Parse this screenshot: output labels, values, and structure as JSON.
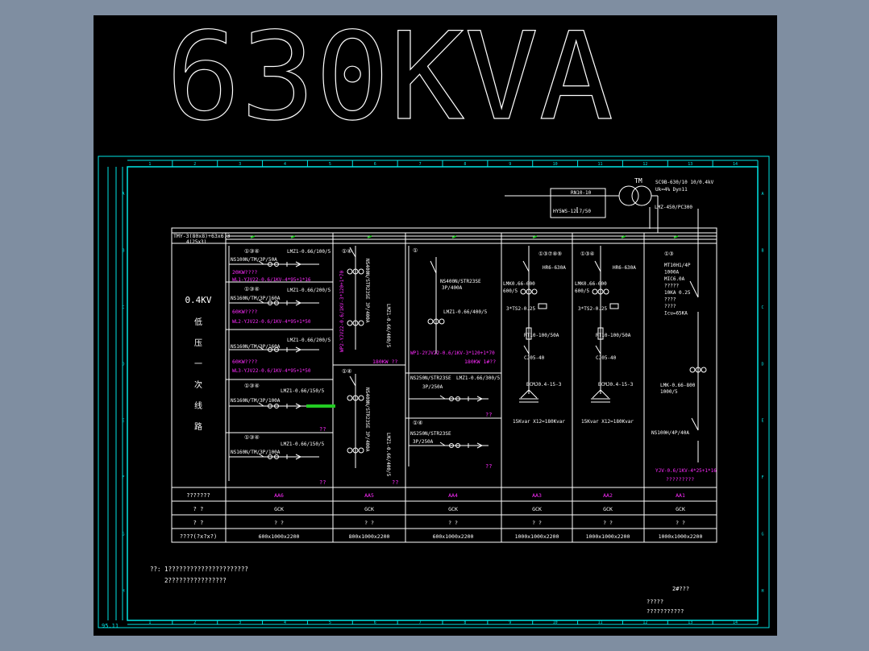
{
  "title": "630KVA",
  "colors": {
    "background": "#000000",
    "frame": "#00e5e5",
    "lines": "#ffffff",
    "magenta": "#ff2bff",
    "green": "#22cc22",
    "outer": "#7f8ea1"
  },
  "border_numbers": [
    "1",
    "2",
    "3",
    "4",
    "5",
    "6",
    "7",
    "8",
    "9",
    "10",
    "11",
    "12",
    "13",
    "14"
  ],
  "border_letters": [
    "A",
    "B",
    "C",
    "D",
    "E",
    "F",
    "G",
    "H"
  ],
  "corner_label": "95.11",
  "transformer": {
    "tm": "TM",
    "model": "SC9B-630/10 10/0.4kV",
    "params": "Uk=4% Dyn11",
    "ct": "LMZ-450/PC300",
    "fuse": "RN10-10",
    "arrester": "HY5WS-12.7/50"
  },
  "busbar": {
    "line1": "TMY-3(80x8)+63x6.3",
    "line2": "4(25x3)"
  },
  "left_label": [
    "0.4KV",
    "低",
    "压",
    "一",
    "次",
    "线",
    "路"
  ],
  "aa6": {
    "f1": {
      "nums": "①③④",
      "ct": "LMZ1-0.66/100/5",
      "brk": "NS100N/TM/3P/50A",
      "load": "20KW????",
      "cable": "WL1-YJV22-0.6/1KV-4*95+1*16"
    },
    "f2": {
      "nums": "①③④",
      "ct": "LMZ1-0.66/200/5",
      "brk": "NS160N/TM/3P/160A",
      "load": "60KW????",
      "cable": "WL2-YJV22-0.6/1KV-4*95+1*50"
    },
    "f3": {
      "ct": "LMZ1-0.66/200/5",
      "brk": "NS160N/TM/3P/160A",
      "load": "60KW????",
      "cable": "WL3-YJV22-0.6/1KV-4*95+1*50"
    },
    "f4": {
      "nums": "①③④",
      "ct": "LMZ1-0.66/150/5",
      "brk": "NS160N/TM/3P/100A",
      "q": "??"
    },
    "f5": {
      "nums": "①③④",
      "ct": "LMZ1-0.66/150/5",
      "brk": "NS160N/TM/3P/100A",
      "q": "??"
    }
  },
  "aa5": {
    "top": {
      "nums": "①④",
      "brk": "NS400N/STR23SE 3P/400A",
      "ct": "LMZ1-0.66/400/5",
      "cable": "WP2-YJV22-0.6/1KV-3*120+1*70",
      "load": "180KW ??"
    },
    "bot": {
      "nums": "①④",
      "brk": "NS400N/STR23SE 3P/400A",
      "ct": "LMZ1-0.66/400/5",
      "q": "??"
    }
  },
  "aa4": {
    "top": {
      "nums": "①",
      "brk": "NS400N/STR23SE",
      "brk2": "3P/400A",
      "ct": "LMZ1-0.66/400/5",
      "cable": "WP1-2YJV22-0.6/1KV-3*120+1*70",
      "load": "180KW 1#??"
    },
    "mid": {
      "brk": "NS250N/STR23SE",
      "ct": "LMZ1-0.66/300/5",
      "brk2": "3P/250A",
      "q": "??"
    },
    "bot": {
      "nums": "①④",
      "brk": "NS250N/STR23SE",
      "brk2": "3P/250A",
      "q": "??"
    }
  },
  "aa3": {
    "nums": "①③⑦⑧⑨",
    "sw": "HR6-630A",
    "ct": "LMK0.66-600",
    "ct2": "600/5",
    "ct3": "3*TS2-0.25",
    "fuse": "RT10-100/50A",
    "cont": "CJ05-40",
    "cap": "BCMJ0.4-15-3",
    "total": "15Kvar X12=180Kvar"
  },
  "aa2": {
    "nums": "①③④",
    "sw": "HR6-630A",
    "ct": "LMK0.66-600",
    "ct2": "600/5",
    "ct3": "3*TS2-0.25",
    "fuse": "RT10-100/50A",
    "cont": "CJ05-40",
    "cap": "BCMJ0.4-15-3",
    "total": "15Kvar X12=180Kvar"
  },
  "aa1": {
    "nums": "①③",
    "lines": [
      "MT10H1/4P",
      "1000A",
      "MIC6.0A",
      "?????",
      "10KA   0.25",
      "????",
      "????",
      "Icu=65KA"
    ],
    "ct": "LMK-0.66-800",
    "ct2": "1000/5",
    "brk2": "NS100H/4P/40A",
    "cable": "YJV-0.6/1KV-4*25+1*16",
    "bottom": "?????????"
  },
  "table": {
    "rows": [
      {
        "label": "???????",
        "values": [
          "AA6",
          "AA5",
          "AA4",
          "AA3",
          "AA2",
          "AA1"
        ]
      },
      {
        "label": "? ?",
        "values": [
          "GCK",
          "GCK",
          "GCK",
          "GCK",
          "GCK",
          "GCK"
        ]
      },
      {
        "label": "? ?",
        "values": [
          "? ?",
          "? ?",
          "? ?",
          "? ?",
          "? ?",
          "? ?"
        ]
      },
      {
        "label": "????(?x?x?)",
        "values": [
          "600x1000x2200",
          "800x1000x2200",
          "600x1000x2200",
          "1000x1000x2200",
          "1000x1000x2200",
          "1000x1000x2200"
        ]
      }
    ]
  },
  "notes": {
    "line1": "??: 1??????????????????????",
    "line2": "2????????????????"
  },
  "bottom_right": {
    "line1": "2#???",
    "line2": "?????",
    "line3": "???????????"
  }
}
